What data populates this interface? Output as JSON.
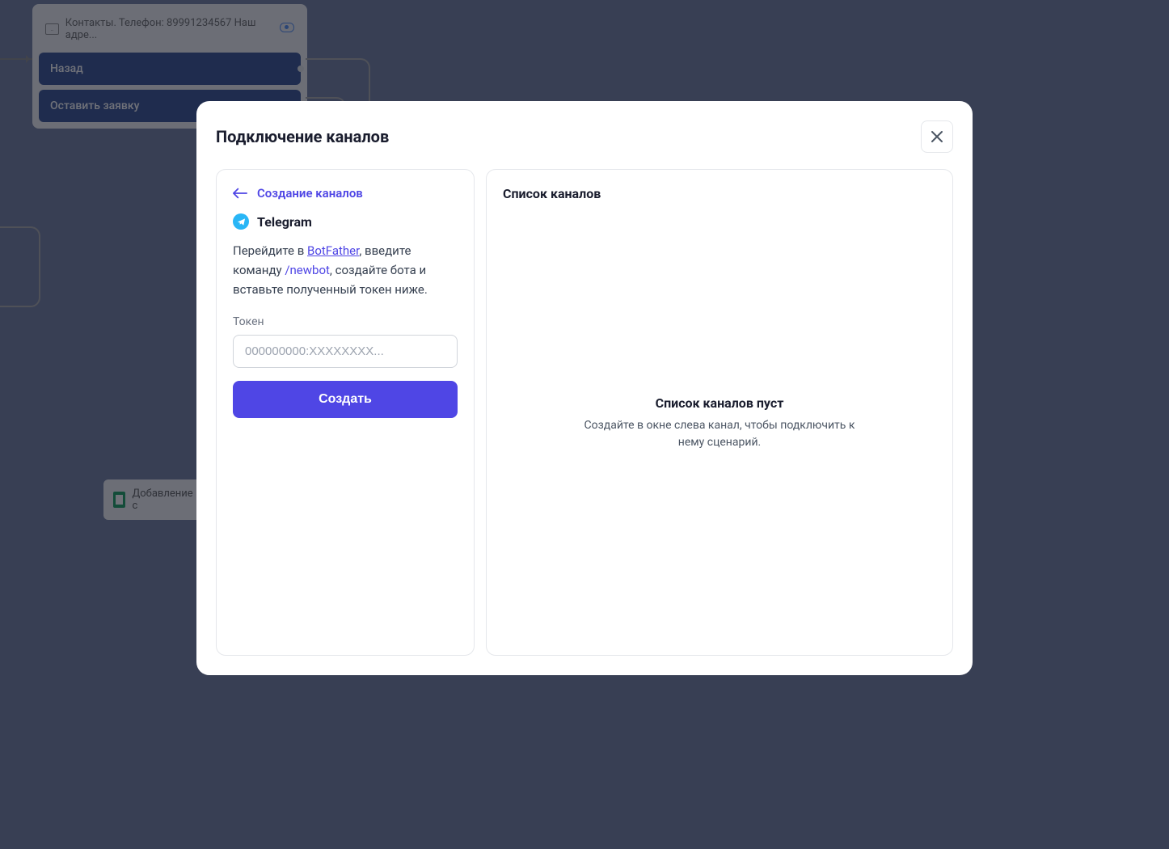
{
  "background": {
    "node1": {
      "header_text": "Контакты. Телефон: 89991234567 Наш адре...",
      "button1": "Назад",
      "button2": "Оставить заявку"
    },
    "node2": {
      "label": "Добавление с"
    }
  },
  "modal": {
    "title": "Подключение каналов",
    "left": {
      "back_label": "Создание каналов",
      "channel_name": "Telegram",
      "instructions": {
        "prefix": "Перейдите в ",
        "link_text": "BotFather",
        "middle": ", введите команду ",
        "command": "/newbot",
        "suffix": ", создайте бота и вставьте полученный токен ниже."
      },
      "token_label": "Токен",
      "token_placeholder": "000000000:XXXXXXXX...",
      "create_button": "Создать"
    },
    "right": {
      "title": "Список каналов",
      "empty_title": "Список каналов пуст",
      "empty_desc": "Создайте в окне слева канал, чтобы подключить к нему сценарий."
    }
  }
}
